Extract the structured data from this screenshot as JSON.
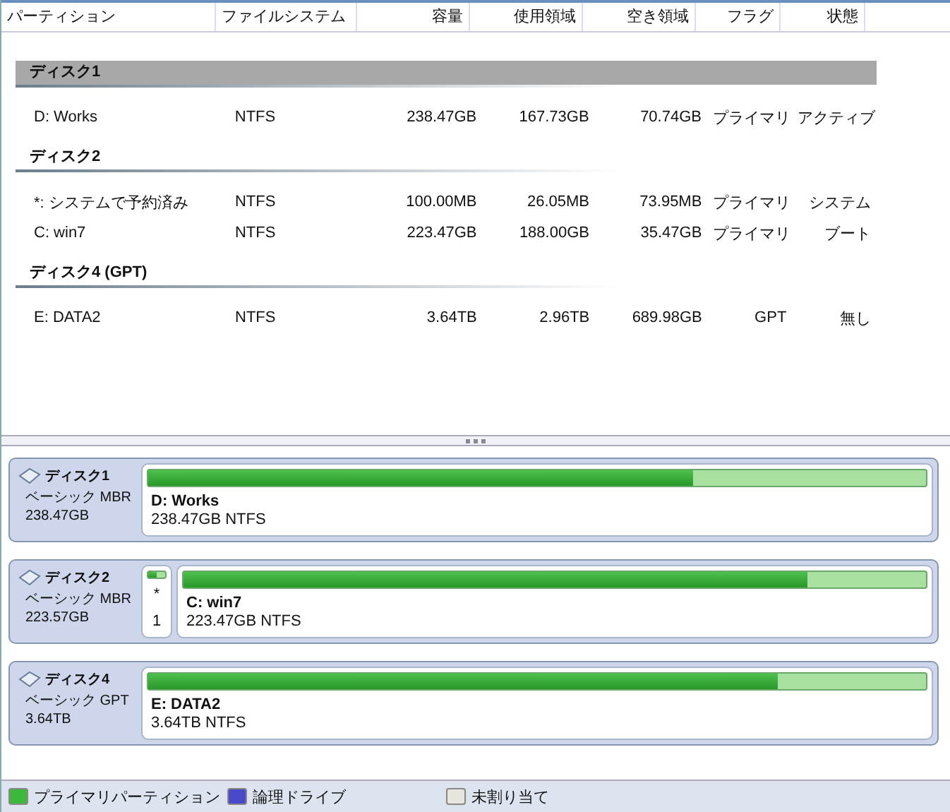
{
  "columns": [
    "パーティション",
    "ファイルシステム",
    "容量",
    "使用領域",
    "空き領域",
    "フラグ",
    "状態"
  ],
  "groups": [
    {
      "name": "ディスク1",
      "selected": true,
      "rows": [
        [
          "D: Works",
          "NTFS",
          "238.47GB",
          "167.73GB",
          "70.74GB",
          "プライマリ",
          "アクティブ"
        ]
      ]
    },
    {
      "name": "ディスク2",
      "selected": false,
      "rows": [
        [
          "*: システムで予約済み",
          "NTFS",
          "100.00MB",
          "26.05MB",
          "73.95MB",
          "プライマリ",
          "システム"
        ],
        [
          "C: win7",
          "NTFS",
          "223.47GB",
          "188.00GB",
          "35.47GB",
          "プライマリ",
          "ブート"
        ]
      ]
    },
    {
      "name": "ディスク4 (GPT)",
      "selected": false,
      "rows": [
        [
          "E: DATA2",
          "NTFS",
          "3.64TB",
          "2.96TB",
          "689.98GB",
          "GPT",
          "無し"
        ]
      ]
    }
  ],
  "disk_map": [
    {
      "name": "ディスク1",
      "type": "ベーシック MBR",
      "size": "238.47GB",
      "partitions": [
        {
          "kind": "full",
          "label": "D: Works",
          "detail": "238.47GB NTFS",
          "level": 0.7
        }
      ]
    },
    {
      "name": "ディスク2",
      "type": "ベーシック MBR",
      "size": "223.57GB",
      "partitions": [
        {
          "kind": "mini",
          "label": "*",
          "detail": "1",
          "level": 0.5
        },
        {
          "kind": "full",
          "label": "C: win7",
          "detail": "223.47GB NTFS",
          "level": 0.84
        }
      ]
    },
    {
      "name": "ディスク4",
      "type": "ベーシック GPT",
      "size": "3.64TB",
      "partitions": [
        {
          "kind": "full",
          "label": "E: DATA2",
          "detail": "3.64TB NTFS",
          "level": 0.81
        }
      ]
    }
  ],
  "legend": [
    {
      "label": "プライマリパーティション",
      "color": "#3cb83c"
    },
    {
      "label": "論理ドライブ",
      "color": "#4a4ac8"
    },
    {
      "label": "未割り当て",
      "color": "#e8e4de"
    }
  ]
}
